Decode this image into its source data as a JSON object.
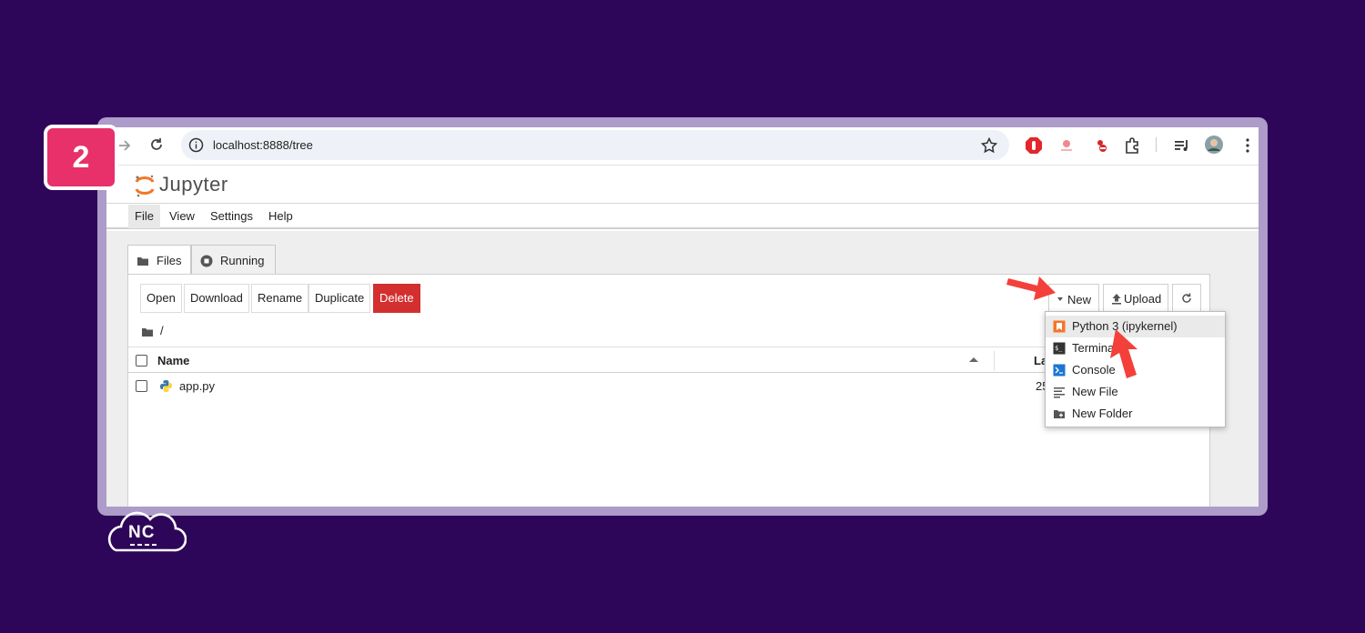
{
  "step": {
    "number": "2"
  },
  "browser": {
    "url": "localhost:8888/tree"
  },
  "jupyter": {
    "logo_text": "Jupyter"
  },
  "menu": {
    "items": [
      "File",
      "View",
      "Settings",
      "Help"
    ]
  },
  "tabs": {
    "files": "Files",
    "running": "Running"
  },
  "toolbar": {
    "open": "Open",
    "download": "Download",
    "rename": "Rename",
    "duplicate": "Duplicate",
    "delete": "Delete",
    "new": "New",
    "upload": "Upload"
  },
  "breadcrumb": {
    "path": "/"
  },
  "file_list": {
    "headers": {
      "name": "Name",
      "last_modified": "La"
    },
    "rows": [
      {
        "name": "app.py",
        "modified": "25"
      }
    ]
  },
  "new_menu": {
    "items": [
      {
        "label": "Python 3 (ipykernel)",
        "icon": "notebook-icon"
      },
      {
        "label": "Terminal",
        "icon": "terminal-icon"
      },
      {
        "label": "Console",
        "icon": "console-icon"
      },
      {
        "label": "New File",
        "icon": "text-file-icon"
      },
      {
        "label": "New Folder",
        "icon": "new-folder-icon"
      }
    ]
  },
  "brand": {
    "logo_text": "NC"
  },
  "colors": {
    "background": "#2e0659",
    "frame": "#ad9bc9",
    "badge": "#e8306b",
    "delete": "#d32f2f",
    "arrow": "#f4403a"
  }
}
